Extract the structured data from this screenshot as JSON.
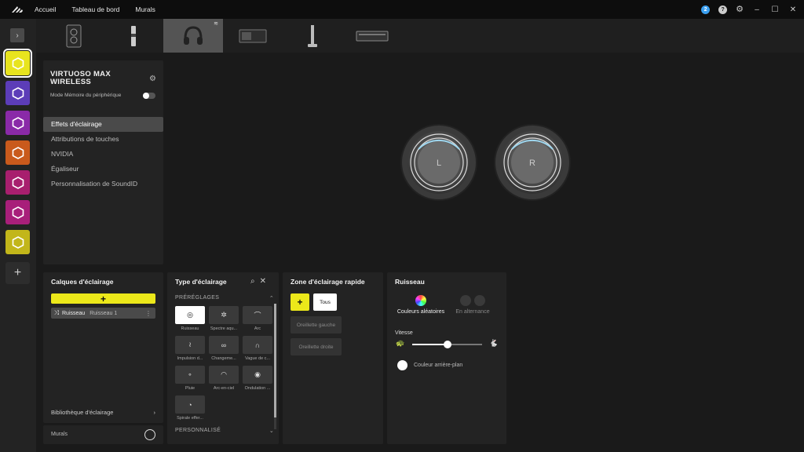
{
  "topbar": {
    "nav": [
      "Accueil",
      "Tableau de bord",
      "Murals"
    ],
    "notification_count": "2",
    "help_glyph": "?"
  },
  "sidebar": {
    "expand_glyph": "›",
    "devices": [
      {
        "color": "#e8e41e",
        "active": true
      },
      {
        "color": "#5c3db8",
        "active": false
      },
      {
        "color": "#8a2aa8",
        "active": false
      },
      {
        "color": "#c95a1c",
        "active": false
      },
      {
        "color": "#a81f6e",
        "active": false
      },
      {
        "color": "#a81f7a",
        "active": false
      },
      {
        "color": "#c2b61a",
        "active": false
      }
    ],
    "add_glyph": "+"
  },
  "device_panel": {
    "title": "VIRTUOSO MAX WIRELESS",
    "memory_mode_label": "Mode Mémoire du périphérique",
    "memory_mode_on": false,
    "menu": [
      "Effets d'éclairage",
      "Attributions de touches",
      "NVIDIA",
      "Égaliseur",
      "Personnalisation de SoundID"
    ],
    "active_menu_index": 0
  },
  "earcups": {
    "left_label": "L",
    "right_label": "R"
  },
  "layers_panel": {
    "title": "Calques d'éclairage",
    "add_glyph": "+",
    "layer": {
      "name": "Ruisseau",
      "sub": "Ruisseau 1"
    },
    "library_label": "Bibliothèque d'éclairage",
    "murals_label": "Murals"
  },
  "type_panel": {
    "title": "Type d'éclairage",
    "presets_label": "PRÉRÉGLAGES",
    "custom_label": "PERSONNALISÉ",
    "effects": [
      {
        "label": "Ruisseau",
        "icon": "spiral-icon",
        "selected": true
      },
      {
        "label": "Spectre aqu...",
        "icon": "spectrum-icon",
        "selected": false
      },
      {
        "label": "Arc",
        "icon": "arc-icon",
        "selected": false
      },
      {
        "label": "Impulsion d...",
        "icon": "pulse-icon",
        "selected": false
      },
      {
        "label": "Changeme...",
        "icon": "link-icon",
        "selected": false
      },
      {
        "label": "Vague de c...",
        "icon": "wave-icon",
        "selected": false
      },
      {
        "label": "Pluie",
        "icon": "rain-icon",
        "selected": false
      },
      {
        "label": "Arc-en-ciel",
        "icon": "rainbow-icon",
        "selected": false
      },
      {
        "label": "Ondulation ...",
        "icon": "ripple-icon",
        "selected": false
      },
      {
        "label": "Spirale effer...",
        "icon": "gauge-icon",
        "selected": false
      }
    ]
  },
  "zone_panel": {
    "title": "Zone d'éclairage rapide",
    "add_glyph": "+",
    "all_label": "Tous",
    "zones": [
      "Oreillette gauche",
      "Oreillette droite"
    ]
  },
  "effect_panel": {
    "title": "Ruisseau",
    "mode_random": "Couleurs aléatoires",
    "mode_alternate": "En alternance",
    "speed_label": "Vitesse",
    "speed_fraction": 0.5,
    "background_label": "Couleur arrière-plan",
    "accent_yellow": "#ece81a"
  }
}
